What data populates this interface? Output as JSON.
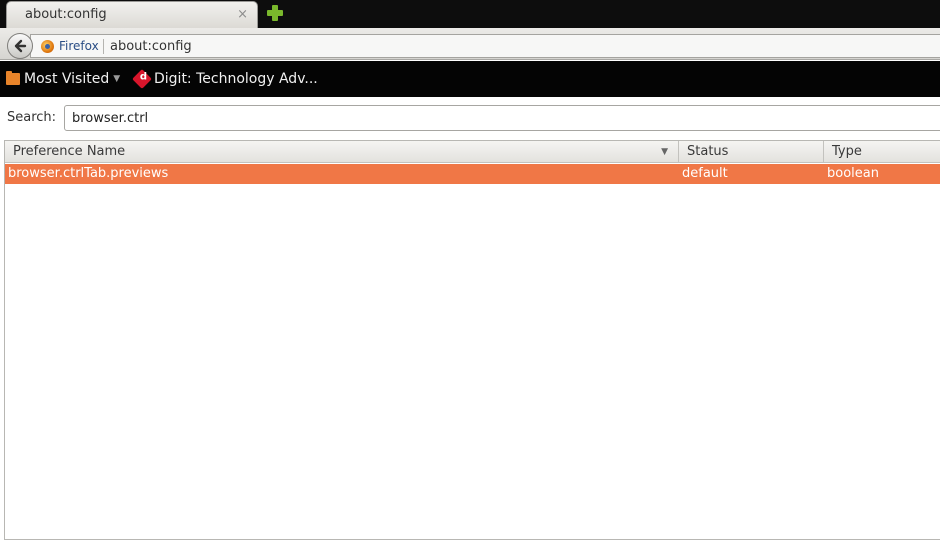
{
  "tab": {
    "title": "about:config",
    "close_glyph": "×"
  },
  "navbar": {
    "identity_label": "Firefox",
    "url": "about:config"
  },
  "bookmarks": [
    {
      "label": "Most Visited",
      "icon": "folder-icon",
      "arrow": "▼"
    },
    {
      "label": "Digit: Technology Adv...",
      "icon": "digit-favicon-icon",
      "icon_letter": "d"
    }
  ],
  "search": {
    "label": "Search:",
    "value": "browser.ctrl"
  },
  "table": {
    "columns": [
      "Preference Name",
      "Status",
      "Type"
    ],
    "rows": [
      {
        "name": "browser.ctrlTab.previews",
        "status": "default",
        "type": "boolean"
      }
    ]
  },
  "colors": {
    "selection": "#f07746",
    "tabstrip": "#0d0d0d",
    "bookmarks_bar": "#040404",
    "newtab": "#7ab82c"
  }
}
